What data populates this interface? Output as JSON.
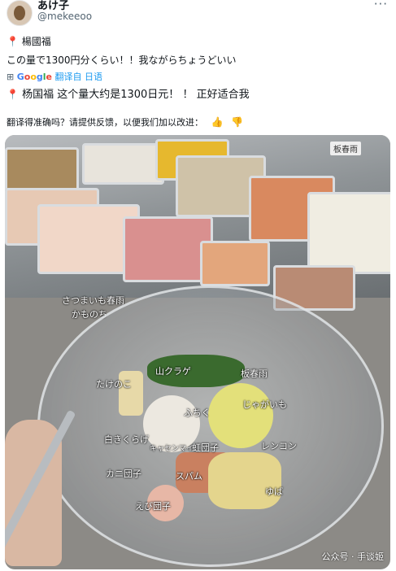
{
  "tweet": {
    "display_name": "あけ子",
    "handle": "@mekeeoo",
    "more_icon": "more-horizontal-icon",
    "location_pin": "📍",
    "location_name": "楊國福",
    "original_text": "この量で1300円分くらい！！我ながらちょうどいい",
    "translation_icon": "translate-icon",
    "translated_by": "翻译自 日语",
    "translated_text": "杨国福 这个量大约是1300日元！ ！ 正好适合我",
    "feedback_text": "翻译得准确吗？请提供反馈，以便我们加以改进：",
    "thumb_up_icon": "thumb-up-icon",
    "thumb_down_icon": "thumb-down-icon"
  },
  "google_logo": {
    "G": "G",
    "o1": "o",
    "o2": "o",
    "g": "g",
    "l": "l",
    "e": "e"
  },
  "photo": {
    "shop_sign": "板春雨",
    "upper_notes": [
      "さつまいも春雨",
      "かものち"
    ],
    "labels": {
      "kikurage_mountain": "山クラゲ",
      "bamboo": "たけのこ",
      "harusame": "板春雨",
      "potato": "じゃがいも",
      "fu": "ふちく",
      "white_fungus": "白きくらげ",
      "seaweed": "キャセンマイ",
      "beef_ball": "虹団子",
      "lotus": "レンコン",
      "crab_ball": "カニ団子",
      "spam": "スパム",
      "yuba": "ゆば",
      "shrimp_ball": "えび団子"
    },
    "watermark": "公众号 · 手谈姬"
  }
}
